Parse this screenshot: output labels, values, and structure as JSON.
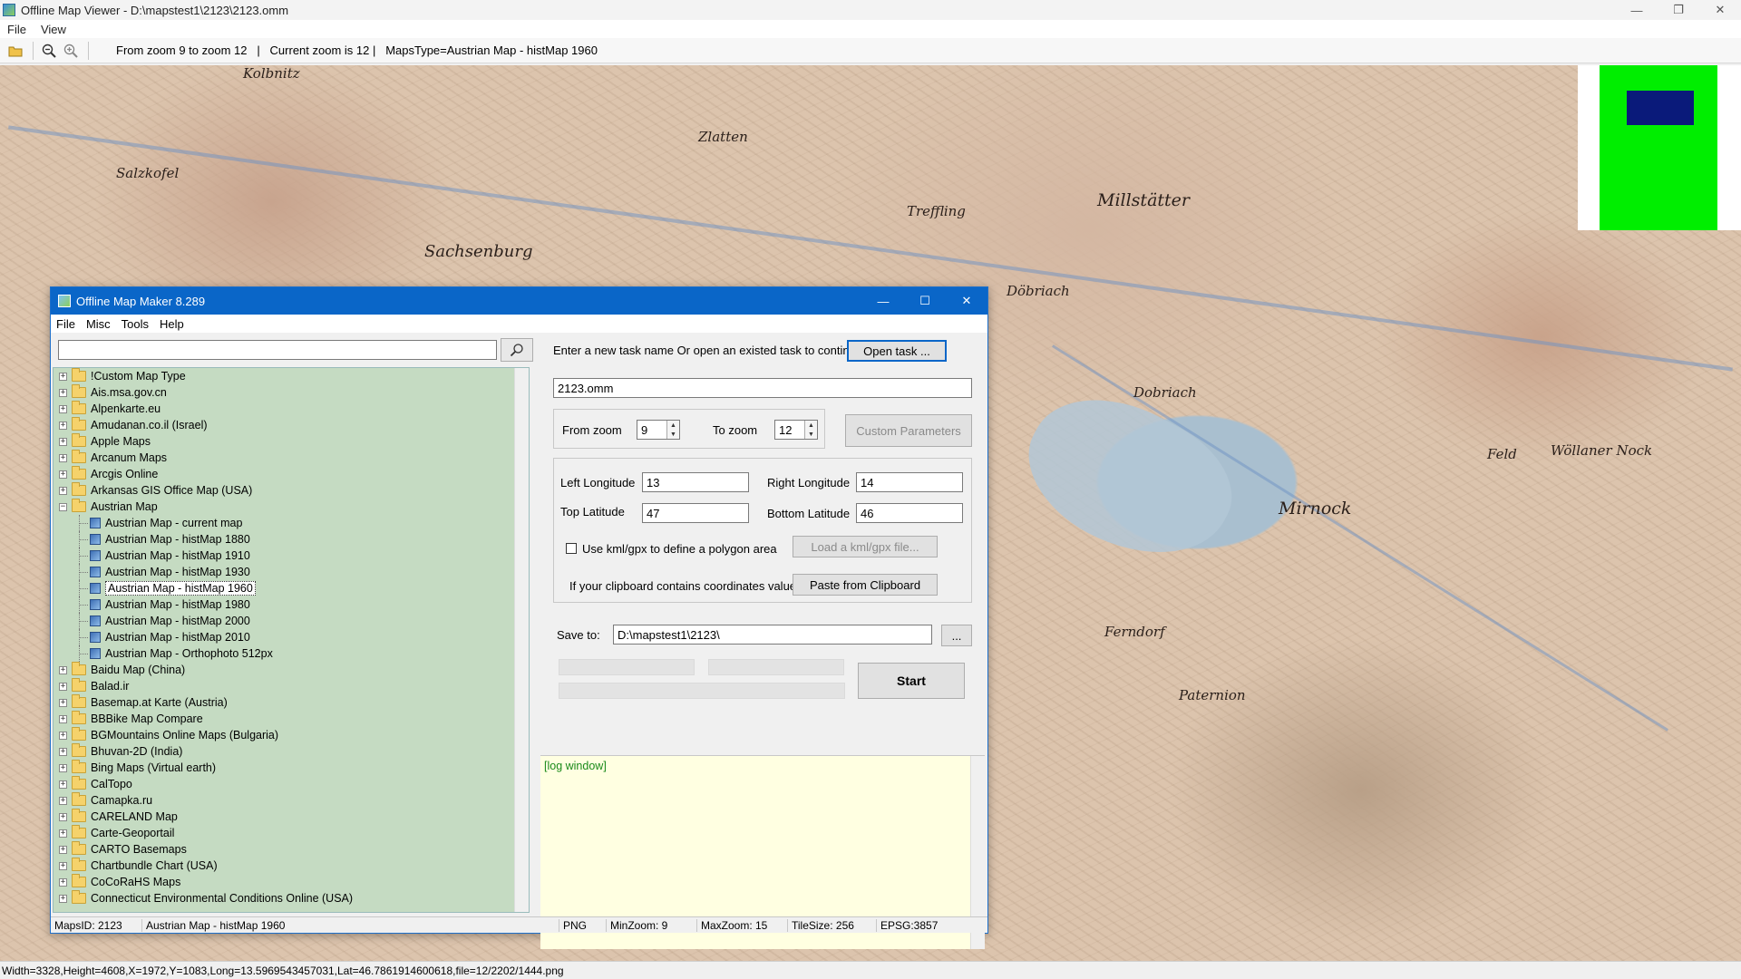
{
  "viewer": {
    "title": "Offline Map Viewer - D:\\mapstest1\\2123\\2123.omm",
    "menu": [
      "File",
      "View"
    ],
    "toolbar_info": "From zoom 9 to zoom 12   |   Current zoom is 12 |   MapsType=Austrian Map - histMap 1960",
    "status": "Width=3328,Height=4608,X=1972,Y=1083,Long=13.5969543457031,Lat=46.7861914600618,file=12/2202/1444.png",
    "map_labels": [
      "Millstätter",
      "Mirnock",
      "Wöllaner Nock",
      "Sachsenburg",
      "Salzkofel",
      "Ferndorf",
      "Paternion",
      "Feld",
      "Treffling",
      "Kolbnitz",
      "Zlatten",
      "Dobriach",
      "Döbriach"
    ]
  },
  "dialog": {
    "title": "Offline Map Maker 8.289",
    "menu": [
      "File",
      "Misc",
      "Tools",
      "Help"
    ],
    "search_value": "",
    "tree": [
      {
        "label": "!Custom Map Type",
        "type": "folder",
        "expanded": false
      },
      {
        "label": "Ais.msa.gov.cn",
        "type": "folder",
        "expanded": false
      },
      {
        "label": "Alpenkarte.eu",
        "type": "folder",
        "expanded": false
      },
      {
        "label": "Amudanan.co.il (Israel)",
        "type": "folder",
        "expanded": false
      },
      {
        "label": "Apple Maps",
        "type": "folder",
        "expanded": false
      },
      {
        "label": "Arcanum Maps",
        "type": "folder",
        "expanded": false
      },
      {
        "label": "Arcgis Online",
        "type": "folder",
        "expanded": false
      },
      {
        "label": "Arkansas GIS Office Map (USA)",
        "type": "folder",
        "expanded": false
      },
      {
        "label": "Austrian Map",
        "type": "folder",
        "expanded": true
      },
      {
        "label": "Austrian Map - current map",
        "type": "map"
      },
      {
        "label": "Austrian Map - histMap 1880",
        "type": "map"
      },
      {
        "label": "Austrian Map - histMap 1910",
        "type": "map"
      },
      {
        "label": "Austrian Map - histMap 1930",
        "type": "map"
      },
      {
        "label": "Austrian Map - histMap 1960",
        "type": "map",
        "selected": true
      },
      {
        "label": "Austrian Map - histMap 1980",
        "type": "map"
      },
      {
        "label": "Austrian Map - histMap 2000",
        "type": "map"
      },
      {
        "label": "Austrian Map - histMap 2010",
        "type": "map"
      },
      {
        "label": "Austrian Map - Orthophoto 512px",
        "type": "map"
      },
      {
        "label": "Baidu Map (China)",
        "type": "folder",
        "expanded": false
      },
      {
        "label": "Balad.ir",
        "type": "folder",
        "expanded": false
      },
      {
        "label": "Basemap.at Karte (Austria)",
        "type": "folder",
        "expanded": false
      },
      {
        "label": "BBBike Map Compare",
        "type": "folder",
        "expanded": false
      },
      {
        "label": "BGMountains Online Maps (Bulgaria)",
        "type": "folder",
        "expanded": false
      },
      {
        "label": "Bhuvan-2D (India)",
        "type": "folder",
        "expanded": false
      },
      {
        "label": "Bing Maps (Virtual earth)",
        "type": "folder",
        "expanded": false
      },
      {
        "label": "CalTopo",
        "type": "folder",
        "expanded": false
      },
      {
        "label": "Camapka.ru",
        "type": "folder",
        "expanded": false
      },
      {
        "label": "CARELAND Map",
        "type": "folder",
        "expanded": false
      },
      {
        "label": "Carte-Geoportail",
        "type": "folder",
        "expanded": false
      },
      {
        "label": "CARTO Basemaps",
        "type": "folder",
        "expanded": false
      },
      {
        "label": "Chartbundle Chart (USA)",
        "type": "folder",
        "expanded": false
      },
      {
        "label": "CoCoRaHS Maps",
        "type": "folder",
        "expanded": false
      },
      {
        "label": "Connecticut Environmental Conditions Online (USA)",
        "type": "folder",
        "expanded": false
      }
    ],
    "task_prompt": "Enter a new task name Or open an existed task to continue:",
    "open_task_label": "Open task ...",
    "task_name": "2123.omm",
    "from_zoom_label": "From zoom",
    "from_zoom": "9",
    "to_zoom_label": "To zoom",
    "to_zoom": "12",
    "custom_params_label": "Custom Parameters",
    "left_lon_label": "Left Longitude",
    "left_lon": "13",
    "right_lon_label": "Right Longitude",
    "right_lon": "14",
    "top_lat_label": "Top Latitude",
    "top_lat": "47",
    "bottom_lat_label": "Bottom Latitude",
    "bottom_lat": "46",
    "kml_label": "Use kml/gpx to define a polygon area",
    "load_kml_label": "Load a kml/gpx file...",
    "clipboard_label": "If your clipboard contains coordinates values:",
    "paste_label": "Paste from Clipboard",
    "save_to_label": "Save to:",
    "save_path": "D:\\mapstest1\\2123\\",
    "browse_label": "...",
    "start_label": "Start",
    "log_text": "[log window]",
    "status": {
      "maps_id": "MapsID: 2123",
      "map_name": "Austrian Map - histMap 1960",
      "format": "PNG",
      "min_zoom": "MinZoom: 9",
      "max_zoom": "MaxZoom: 15",
      "tile_size": "TileSize: 256",
      "epsg": "EPSG:3857"
    }
  }
}
